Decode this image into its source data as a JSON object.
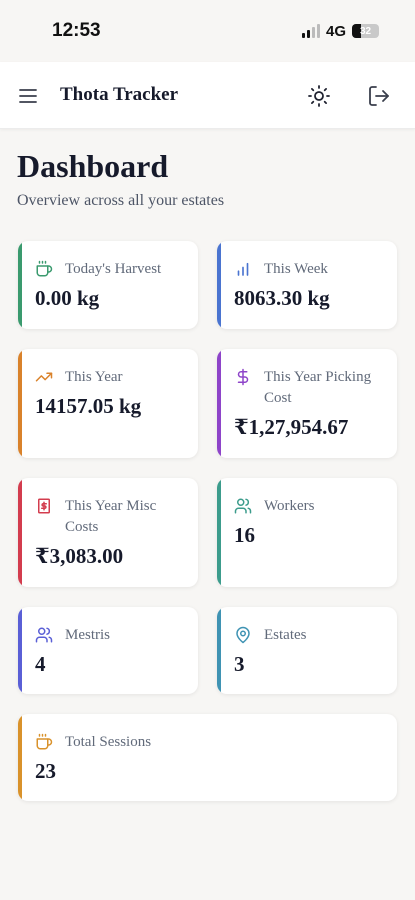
{
  "status_bar": {
    "time": "12:53",
    "network": "4G",
    "battery": "32"
  },
  "header": {
    "title": "Thota Tracker"
  },
  "page": {
    "title": "Dashboard",
    "subtitle": "Overview across all your estates"
  },
  "cards": [
    {
      "label": "Today's Harvest",
      "value": "0.00 kg",
      "icon": "cup-icon",
      "color": "#3a9a6e"
    },
    {
      "label": "This Week",
      "value": "8063.30 kg",
      "icon": "bar-chart-icon",
      "color": "#4a74d0"
    },
    {
      "label": "This Year",
      "value": "14157.05 kg",
      "icon": "trending-up-icon",
      "color": "#d9822b"
    },
    {
      "label": "This Year Picking Cost",
      "value": "₹1,27,954.67",
      "icon": "dollar-icon",
      "color": "#8e44c9"
    },
    {
      "label": "This Year Misc Costs",
      "value": "₹3,083.00",
      "icon": "receipt-icon",
      "color": "#d33c4e"
    },
    {
      "label": "Workers",
      "value": "16",
      "icon": "users-icon",
      "color": "#3c9c8c"
    },
    {
      "label": "Mestris",
      "value": "4",
      "icon": "users-icon",
      "color": "#5a5fd6"
    },
    {
      "label": "Estates",
      "value": "3",
      "icon": "map-pin-icon",
      "color": "#3f93b3"
    },
    {
      "label": "Total Sessions",
      "value": "23",
      "icon": "cup-icon",
      "color": "#d9922b"
    }
  ]
}
